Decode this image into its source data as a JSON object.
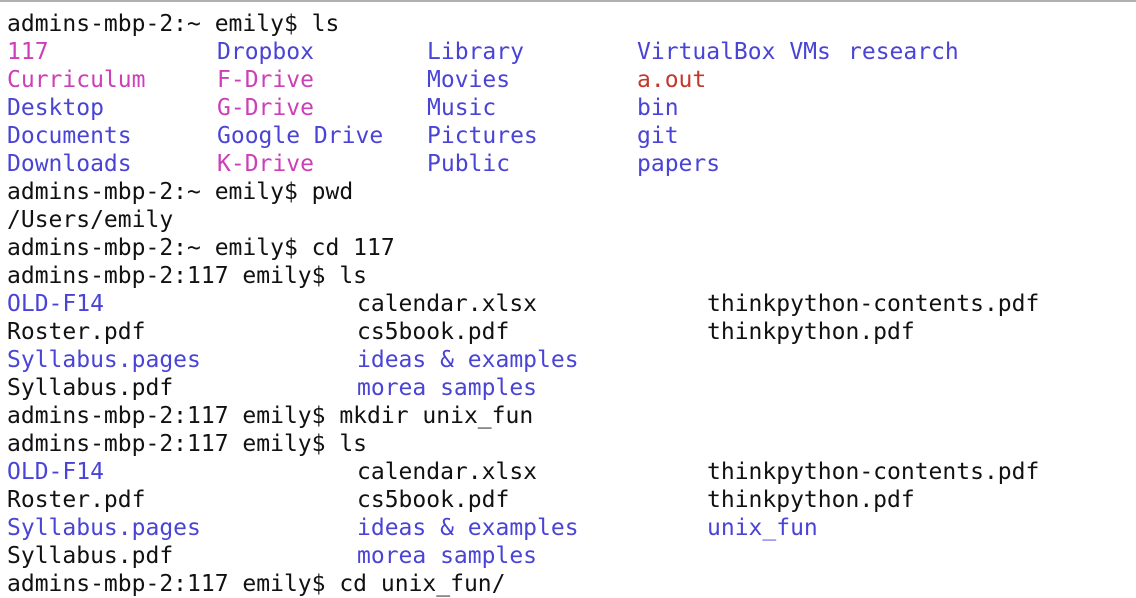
{
  "colors": {
    "text": "#111111",
    "directory": "#4a44d6",
    "special": "#cc3fb8",
    "executable": "#c2382b",
    "background": "#ffffff"
  },
  "lines": [
    {
      "kind": "prompt",
      "text": "admins-mbp-2:~ emily$ ls"
    },
    {
      "kind": "listing",
      "items": [
        {
          "text": "117",
          "color": "special",
          "col": 0
        },
        {
          "text": "Dropbox",
          "color": "dir",
          "col": 1
        },
        {
          "text": "Library",
          "color": "dir",
          "col": 2
        },
        {
          "text": "VirtualBox VMs",
          "color": "dir",
          "col": 3
        },
        {
          "text": "research",
          "color": "dir",
          "col": 4
        }
      ]
    },
    {
      "kind": "listing",
      "items": [
        {
          "text": "Curriculum",
          "color": "special",
          "col": 0
        },
        {
          "text": "F-Drive",
          "color": "special",
          "col": 1
        },
        {
          "text": "Movies",
          "color": "dir",
          "col": 2
        },
        {
          "text": "a.out",
          "color": "exec",
          "col": 3
        }
      ]
    },
    {
      "kind": "listing",
      "items": [
        {
          "text": "Desktop",
          "color": "dir",
          "col": 0
        },
        {
          "text": "G-Drive",
          "color": "special",
          "col": 1
        },
        {
          "text": "Music",
          "color": "dir",
          "col": 2
        },
        {
          "text": "bin",
          "color": "dir",
          "col": 3
        }
      ]
    },
    {
      "kind": "listing",
      "items": [
        {
          "text": "Documents",
          "color": "dir",
          "col": 0
        },
        {
          "text": "Google Drive",
          "color": "dir",
          "col": 1
        },
        {
          "text": "Pictures",
          "color": "dir",
          "col": 2
        },
        {
          "text": "git",
          "color": "dir",
          "col": 3
        }
      ]
    },
    {
      "kind": "listing",
      "items": [
        {
          "text": "Downloads",
          "color": "dir",
          "col": 0
        },
        {
          "text": "K-Drive",
          "color": "special",
          "col": 1
        },
        {
          "text": "Public",
          "color": "dir",
          "col": 2
        },
        {
          "text": "papers",
          "color": "dir",
          "col": 3
        }
      ]
    },
    {
      "kind": "prompt",
      "text": "admins-mbp-2:~ emily$ pwd"
    },
    {
      "kind": "output",
      "text": "/Users/emily"
    },
    {
      "kind": "prompt",
      "text": "admins-mbp-2:~ emily$ cd 117"
    },
    {
      "kind": "prompt",
      "text": "admins-mbp-2:117 emily$ ls"
    },
    {
      "kind": "listing",
      "layout": "wide",
      "items": [
        {
          "text": "OLD-F14",
          "color": "dir",
          "col": 0
        },
        {
          "text": "calendar.xlsx",
          "color": "text",
          "col": 1
        },
        {
          "text": "thinkpython-contents.pdf",
          "color": "text",
          "col": 2
        }
      ]
    },
    {
      "kind": "listing",
      "layout": "wide",
      "items": [
        {
          "text": "Roster.pdf",
          "color": "text",
          "col": 0
        },
        {
          "text": "cs5book.pdf",
          "color": "text",
          "col": 1
        },
        {
          "text": "thinkpython.pdf",
          "color": "text",
          "col": 2
        }
      ]
    },
    {
      "kind": "listing",
      "layout": "wide",
      "items": [
        {
          "text": "Syllabus.pages",
          "color": "dir",
          "col": 0
        },
        {
          "text": "ideas & examples",
          "color": "dir",
          "col": 1
        }
      ]
    },
    {
      "kind": "listing",
      "layout": "wide",
      "items": [
        {
          "text": "Syllabus.pdf",
          "color": "text",
          "col": 0
        },
        {
          "text": "morea samples",
          "color": "dir",
          "col": 1
        }
      ]
    },
    {
      "kind": "prompt",
      "text": "admins-mbp-2:117 emily$ mkdir unix_fun"
    },
    {
      "kind": "prompt",
      "text": "admins-mbp-2:117 emily$ ls"
    },
    {
      "kind": "listing",
      "layout": "wide",
      "items": [
        {
          "text": "OLD-F14",
          "color": "dir",
          "col": 0
        },
        {
          "text": "calendar.xlsx",
          "color": "text",
          "col": 1
        },
        {
          "text": "thinkpython-contents.pdf",
          "color": "text",
          "col": 2
        }
      ]
    },
    {
      "kind": "listing",
      "layout": "wide",
      "items": [
        {
          "text": "Roster.pdf",
          "color": "text",
          "col": 0
        },
        {
          "text": "cs5book.pdf",
          "color": "text",
          "col": 1
        },
        {
          "text": "thinkpython.pdf",
          "color": "text",
          "col": 2
        }
      ]
    },
    {
      "kind": "listing",
      "layout": "wide",
      "items": [
        {
          "text": "Syllabus.pages",
          "color": "dir",
          "col": 0
        },
        {
          "text": "ideas & examples",
          "color": "dir",
          "col": 1
        },
        {
          "text": "unix_fun",
          "color": "dir",
          "col": 2
        }
      ]
    },
    {
      "kind": "listing",
      "layout": "wide",
      "items": [
        {
          "text": "Syllabus.pdf",
          "color": "text",
          "col": 0
        },
        {
          "text": "morea samples",
          "color": "dir",
          "col": 1
        }
      ]
    },
    {
      "kind": "prompt",
      "text": "admins-mbp-2:117 emily$ cd unix_fun/"
    }
  ]
}
